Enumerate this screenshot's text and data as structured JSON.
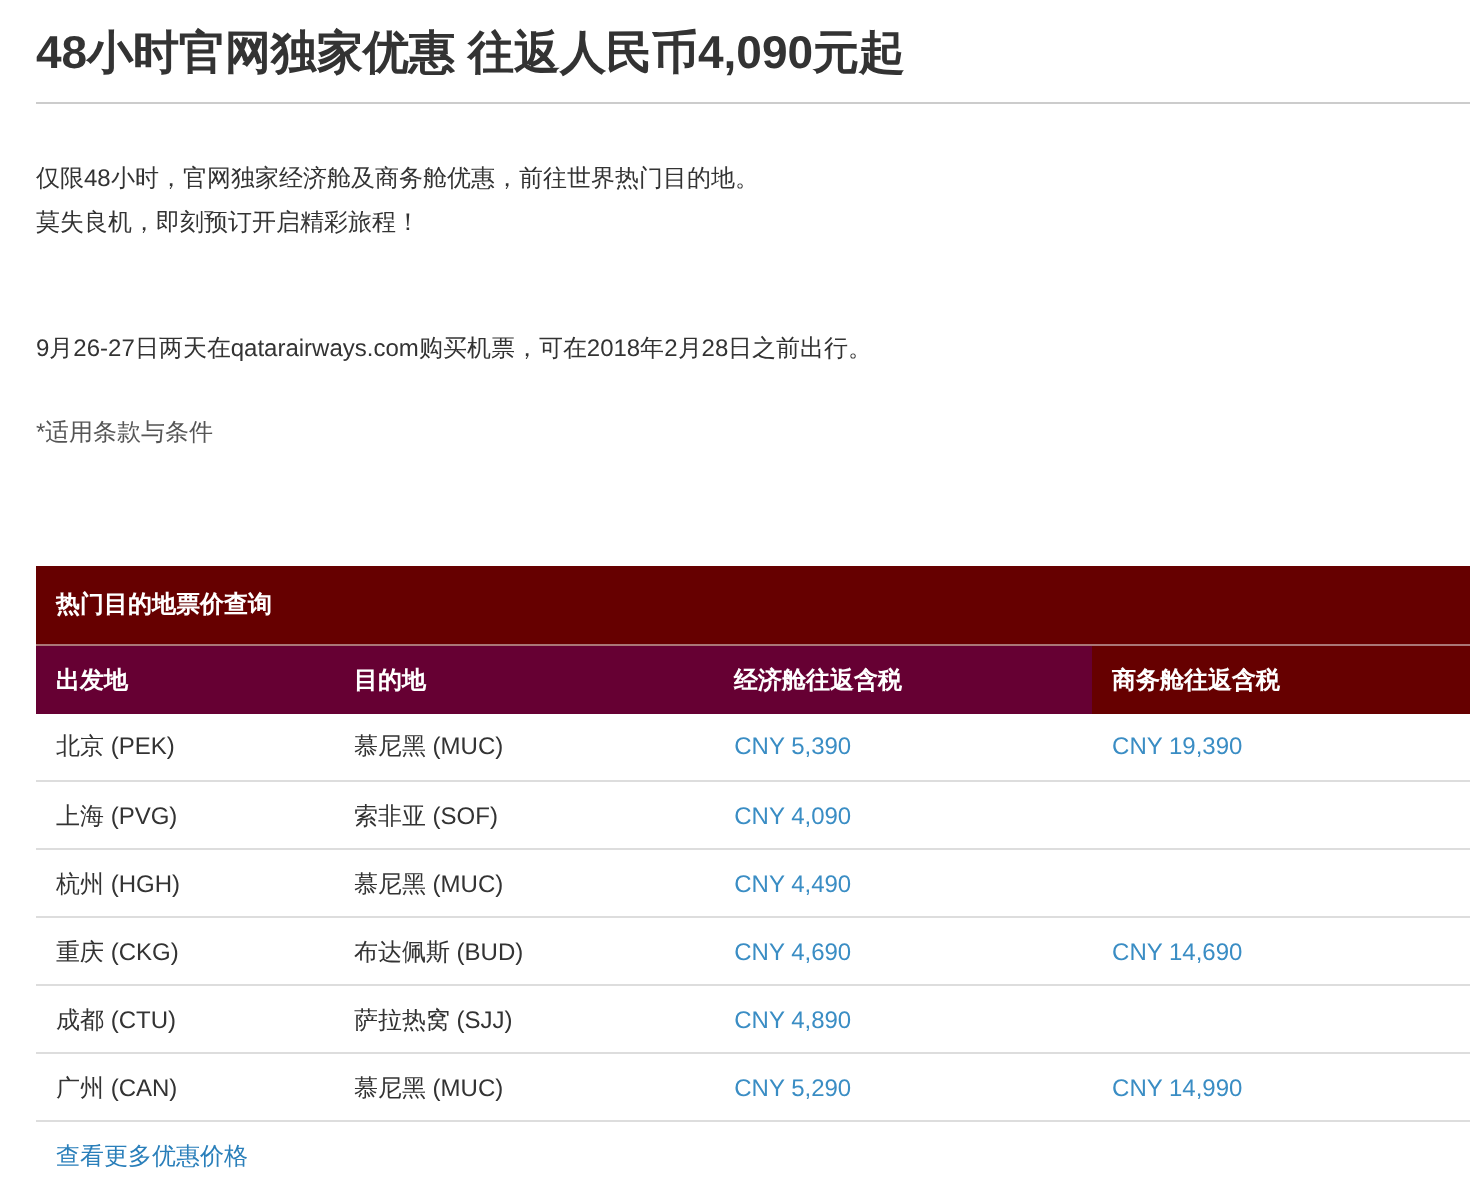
{
  "title": "48小时官网独家优惠 往返人民币4,090元起",
  "intro": [
    "仅限48小时，官网独家经济舱及商务舱优惠，前往世界热门目的地。",
    "莫失良机，即刻预订开启精彩旅程！"
  ],
  "sale_note": "9月26-27日两天在qatarairways.com购买机票，可在2018年2月28日之前出行。",
  "terms_link": "*适用条款与条件",
  "table": {
    "title": "热门目的地票价查询",
    "columns": [
      "出发地",
      "目的地",
      "经济舱往返含税",
      "商务舱往返含税"
    ],
    "rows": [
      {
        "origin": "北京 (PEK)",
        "destination": "慕尼黑 (MUC)",
        "economy": "CNY 5,390",
        "business": "CNY 19,390"
      },
      {
        "origin": "上海 (PVG)",
        "destination": "索非亚 (SOF)",
        "economy": "CNY 4,090"
      },
      {
        "origin": "杭州 (HGH)",
        "destination": "慕尼黑 (MUC)",
        "economy": "CNY 4,490"
      },
      {
        "origin": "重庆 (CKG)",
        "destination": "布达佩斯 (BUD)",
        "economy": "CNY 4,690",
        "business": "CNY 14,690"
      },
      {
        "origin": "成都 (CTU)",
        "destination": "萨拉热窝 (SJJ)",
        "economy": "CNY 4,890"
      },
      {
        "origin": "广州 (CAN)",
        "destination": "慕尼黑 (MUC)",
        "economy": "CNY 5,290",
        "business": "CNY 14,990"
      }
    ]
  },
  "more_link": "查看更多优惠价格"
}
